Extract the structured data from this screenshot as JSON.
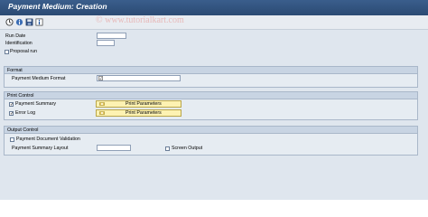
{
  "window": {
    "title": "Payment Medium: Creation"
  },
  "watermark": "© www.tutorialkart.com",
  "toolbar": {
    "icons": [
      "execute-icon",
      "info-icon",
      "save-variant-icon",
      "details-icon"
    ]
  },
  "fields": {
    "run_date_label": "Run Date",
    "run_date_value": "",
    "identification_label": "Identification",
    "identification_value": "",
    "proposal_run_label": "Proposal run",
    "proposal_run_checked": false
  },
  "format_group": {
    "title": "Format",
    "payment_medium_format_label": "Payment Medium Format",
    "payment_medium_format_value": ""
  },
  "print_control_group": {
    "title": "Print Control",
    "payment_summary_label": "Payment Summary",
    "payment_summary_checked": true,
    "error_log_label": "Error Log",
    "error_log_checked": true,
    "print_parameters_label_1": "Print Parameters",
    "print_parameters_label_2": "Print Parameters"
  },
  "output_control_group": {
    "title": "Output Control",
    "payment_document_validation_label": "Payment Document Validation",
    "payment_document_validation_checked": false,
    "payment_summary_layout_label": "Payment Summary Layout",
    "payment_summary_layout_value": "",
    "screen_output_label": "Screen Output",
    "screen_output_checked": false
  },
  "colors": {
    "title_bar": "#2b4a73",
    "group_header": "#c8d4e3",
    "param_button": "#fdf2b2"
  }
}
